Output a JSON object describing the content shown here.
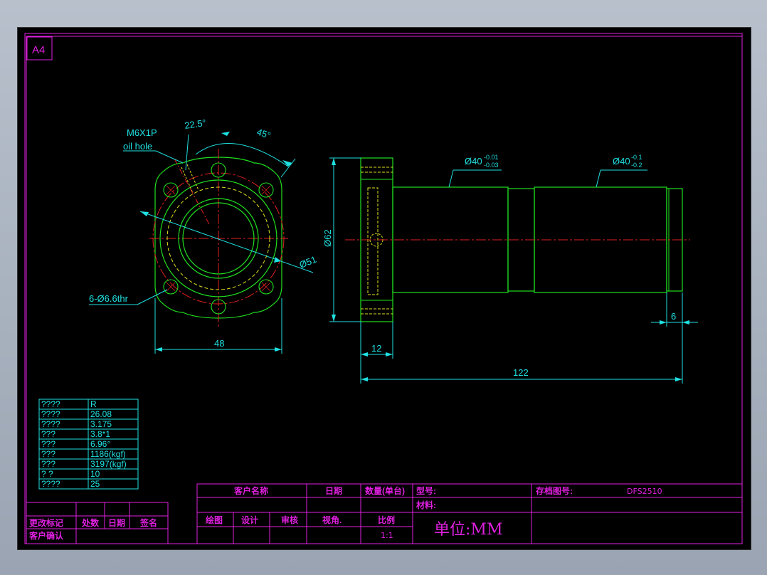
{
  "sheet": {
    "size_label": "A4"
  },
  "flange_view": {
    "thread_label": "M6X1P",
    "oil_hole_label": "oil hole",
    "angle_small": "22.5°",
    "angle_large": "45°",
    "pcd_label": "Ø51",
    "holes_label": "6-Ø6.6thr",
    "width_label": "48"
  },
  "side_view": {
    "flange_dia_label": "Ø62",
    "shaft_dia1": "Ø40",
    "shaft_tol1_upper": "-0.01",
    "shaft_tol1_lower": "-0.03",
    "shaft_dia2": "Ø40",
    "shaft_tol2_upper": "-0.1",
    "shaft_tol2_lower": "-0.2",
    "flange_thickness": "12",
    "total_length": "122",
    "end_length": "6"
  },
  "spec_table": {
    "rows": [
      [
        "????",
        "R"
      ],
      [
        "????",
        "26.08"
      ],
      [
        "????",
        "3.175"
      ],
      [
        "???",
        "3.8*1"
      ],
      [
        "???",
        "6.96°"
      ],
      [
        "???",
        "1186(kgf)"
      ],
      [
        "???",
        "3197(kgf)"
      ],
      [
        "? ?",
        "10"
      ],
      [
        "????",
        "25"
      ]
    ]
  },
  "revision_block": {
    "change_mark": "更改标记",
    "places": "处数",
    "date": "日期",
    "sign": "签名",
    "customer_confirm": "客户确认"
  },
  "title_block": {
    "customer_name": "客户名称",
    "date": "日期",
    "qty": "数量(单台)",
    "model_no": "型号:",
    "archive_no": "存档图号:",
    "archive_value": "DFS2510",
    "material": "材料:",
    "drawn": "绘图",
    "design": "设计",
    "check": "审核",
    "view_angle": "视角.",
    "scale": "比例",
    "scale_value": "1:1",
    "unit": "单位:MM"
  }
}
